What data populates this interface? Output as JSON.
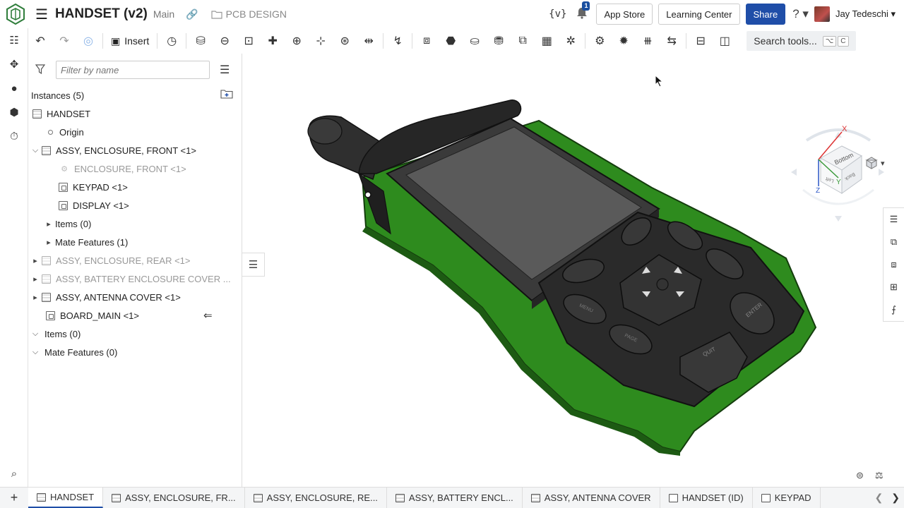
{
  "header": {
    "doc_title": "HANDSET (v2)",
    "branch": "Main",
    "folder": "PCB DESIGN",
    "variable_icon": "{v}",
    "notification_count": "1",
    "app_store": "App Store",
    "learning_center": "Learning Center",
    "share": "Share",
    "help_icon": "?",
    "username": "Jay Tedeschi"
  },
  "toolbar": {
    "insert": "Insert",
    "search_tools": "Search tools...",
    "shortcut_1": "⌥",
    "shortcut_2": "C"
  },
  "panel": {
    "filter_placeholder": "Filter by name",
    "instances_header": "Instances (5)",
    "tree": [
      {
        "label": "HANDSET"
      },
      {
        "label": "Origin"
      },
      {
        "label": "ASSY, ENCLOSURE, FRONT <1>"
      },
      {
        "label": "ENCLOSURE, FRONT <1>"
      },
      {
        "label": "KEYPAD <1>"
      },
      {
        "label": "DISPLAY <1>"
      },
      {
        "label": "Items (0)"
      },
      {
        "label": "Mate Features (1)"
      },
      {
        "label": "ASSY, ENCLOSURE, REAR <1>"
      },
      {
        "label": "ASSY, BATTERY ENCLOSURE COVER ..."
      },
      {
        "label": "ASSY, ANTENNA COVER <1>"
      },
      {
        "label": "BOARD_MAIN <1>"
      },
      {
        "label": "Items (0)"
      },
      {
        "label": "Mate Features (0)"
      }
    ]
  },
  "viewcube": {
    "top_face": "Bottom",
    "axis_x": "X",
    "axis_y": "Y",
    "axis_z": "Z",
    "front_face": "Left",
    "right_face": "Back"
  },
  "keypad": {
    "quit": "QUIT",
    "enter": "ENTER",
    "page": "PAGE",
    "menu": "MENU"
  },
  "tabs": [
    {
      "label": "HANDSET"
    },
    {
      "label": "ASSY, ENCLOSURE, FR..."
    },
    {
      "label": "ASSY, ENCLOSURE, RE..."
    },
    {
      "label": "ASSY, BATTERY ENCL..."
    },
    {
      "label": "ASSY, ANTENNA COVER"
    },
    {
      "label": "HANDSET (ID)"
    },
    {
      "label": "KEYPAD"
    }
  ],
  "colors": {
    "accent": "#1f4ea8",
    "pcb_green": "#2e8b1e",
    "device_dark": "#2a2a2a"
  }
}
